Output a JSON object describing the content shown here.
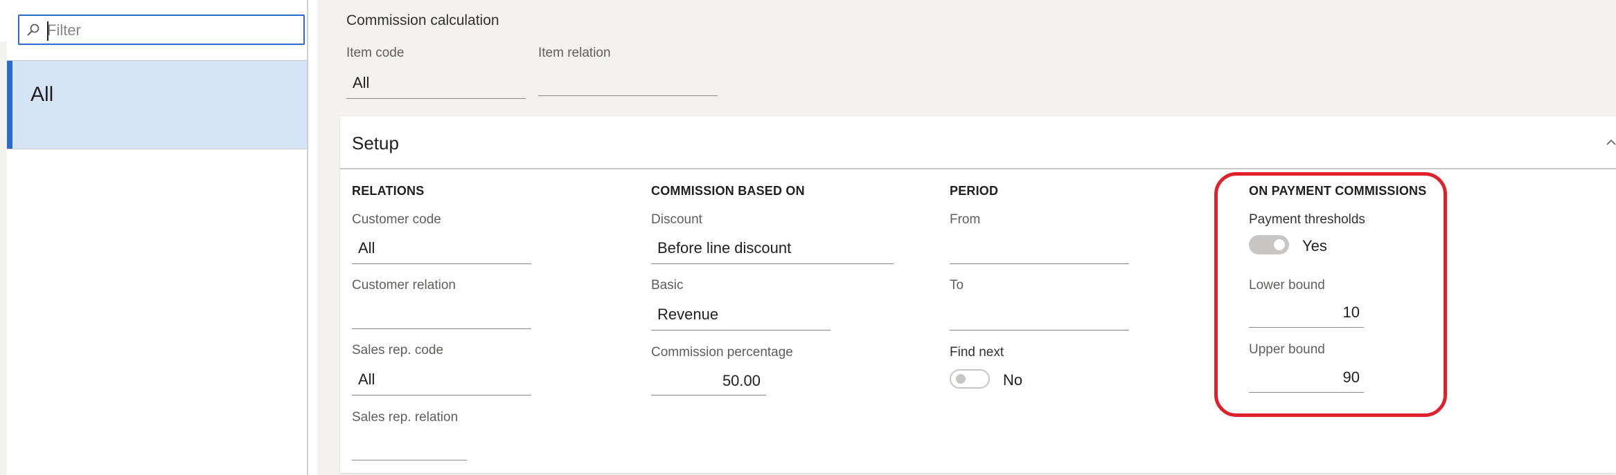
{
  "left_panel": {
    "filter_placeholder": "Filter",
    "items": [
      {
        "label": "All",
        "selected": true
      }
    ]
  },
  "main": {
    "section_title": "Commission calculation",
    "item_code": {
      "label": "Item code",
      "value": "All"
    },
    "item_relation": {
      "label": "Item relation",
      "value": ""
    }
  },
  "setup": {
    "title": "Setup",
    "relations": {
      "heading": "RELATIONS",
      "customer_code": {
        "label": "Customer code",
        "value": "All"
      },
      "customer_relation": {
        "label": "Customer relation",
        "value": ""
      },
      "sales_rep_code": {
        "label": "Sales rep. code",
        "value": "All"
      },
      "sales_rep_relation": {
        "label": "Sales rep. relation",
        "value": ""
      }
    },
    "commission_based_on": {
      "heading": "COMMISSION BASED ON",
      "discount": {
        "label": "Discount",
        "value": "Before line discount"
      },
      "basic": {
        "label": "Basic",
        "value": "Revenue"
      },
      "commission_percentage": {
        "label": "Commission percentage",
        "value": "50.00"
      }
    },
    "period": {
      "heading": "PERIOD",
      "from": {
        "label": "From",
        "value": ""
      },
      "to": {
        "label": "To",
        "value": ""
      },
      "find_next": {
        "label": "Find next",
        "value": "No",
        "on": false
      }
    },
    "on_payment": {
      "heading": "ON PAYMENT COMMISSIONS",
      "payment_thresholds": {
        "label": "Payment thresholds",
        "value": "Yes",
        "on": true
      },
      "lower_bound": {
        "label": "Lower bound",
        "value": "10"
      },
      "upper_bound": {
        "label": "Upper bound",
        "value": "90"
      }
    }
  },
  "colors": {
    "accent": "#2b6bd1",
    "selected_bg": "#d6e4f8",
    "highlight": "#e0202b",
    "page_bg": "#f3f2f1"
  }
}
